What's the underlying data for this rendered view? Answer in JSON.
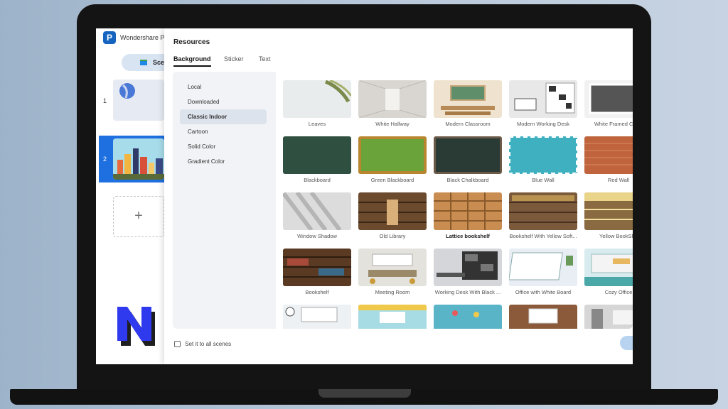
{
  "app": {
    "name": "Wondershare Pre",
    "logo_letter": "P"
  },
  "scenes": {
    "tab_label": "Sce",
    "items": [
      {
        "number": "1"
      },
      {
        "number": "2"
      }
    ],
    "add_symbol": "+"
  },
  "dialog": {
    "title": "Resources",
    "tabs": [
      {
        "label": "Background"
      },
      {
        "label": "Sticker"
      },
      {
        "label": "Text"
      }
    ],
    "categories": [
      {
        "label": "Local"
      },
      {
        "label": "Downloaded"
      },
      {
        "label": "Classic Indoor"
      },
      {
        "label": "Cartoon"
      },
      {
        "label": "Solid Color"
      },
      {
        "label": "Gradient Color"
      }
    ],
    "tiles": [
      {
        "label": "Leaves"
      },
      {
        "label": "White Hallway"
      },
      {
        "label": "Modern Classroom"
      },
      {
        "label": "Modern Working Desk"
      },
      {
        "label": "White Framed Chalk"
      },
      {
        "label": "Blackboard"
      },
      {
        "label": "Green Blackboard"
      },
      {
        "label": "Black Chalkboard"
      },
      {
        "label": "Blue Wall"
      },
      {
        "label": "Red Wall"
      },
      {
        "label": "Window Shadow"
      },
      {
        "label": "Old Library"
      },
      {
        "label": "Lattice bookshelf"
      },
      {
        "label": "Bookshelf With Yellow Soft..."
      },
      {
        "label": "Yellow BookShe"
      },
      {
        "label": "Bookshelf"
      },
      {
        "label": "Meeting Room"
      },
      {
        "label": "Working Desk With Black ..."
      },
      {
        "label": "Office with White Board"
      },
      {
        "label": "Cozy Office"
      }
    ],
    "footer_checkbox_label": "Set it to all scenes"
  },
  "colors": {
    "accent": "#1e6fe0",
    "selected_category_bg": "#dde3ec"
  }
}
